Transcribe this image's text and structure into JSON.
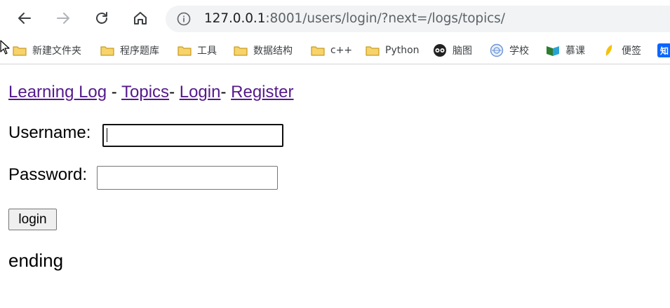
{
  "browser": {
    "url_host": "127.0.0.1",
    "url_rest": ":8001/users/login/?next=/logs/topics/",
    "bookmarks": [
      {
        "label": "新建文件夹",
        "icon": "folder-icon"
      },
      {
        "label": "程序题库",
        "icon": "folder-icon"
      },
      {
        "label": "工具",
        "icon": "folder-icon"
      },
      {
        "label": "数据结构",
        "icon": "folder-icon"
      },
      {
        "label": "c++",
        "icon": "folder-icon"
      },
      {
        "label": "Python",
        "icon": "folder-icon"
      },
      {
        "label": "脑图",
        "icon": "owl-icon"
      },
      {
        "label": "学校",
        "icon": "school-emblem-icon"
      },
      {
        "label": "慕课",
        "icon": "mooc-icon"
      },
      {
        "label": "便签",
        "icon": "note-leaf-icon"
      },
      {
        "label": "知",
        "icon": "zhihu-icon"
      }
    ]
  },
  "page": {
    "nav": {
      "home_link": "Learning Log",
      "sep1": " - ",
      "topics_link": "Topics",
      "sep2": "- ",
      "login_link": "Login",
      "sep3": "- ",
      "register_link": "Register"
    },
    "form": {
      "username_label": "Username:",
      "username_value": "",
      "password_label": "Password:",
      "password_value": "",
      "submit_label": "login"
    },
    "footer_text": "ending"
  },
  "colors": {
    "link_visited": "#551a8b",
    "folder_fill": "#f6d36b",
    "folder_stroke": "#c99a1e"
  }
}
